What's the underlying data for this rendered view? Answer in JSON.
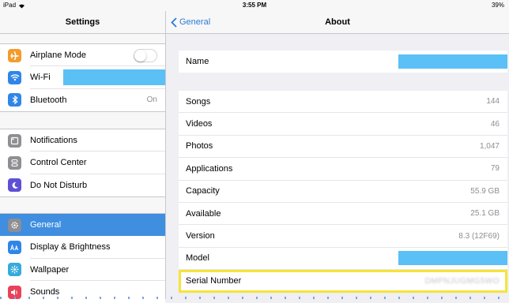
{
  "status": {
    "device": "iPad",
    "time": "3:55 PM",
    "battery": "39%"
  },
  "sidebar": {
    "title": "Settings",
    "groups": [
      {
        "items": [
          {
            "label": "Airplane Mode",
            "icon": "airplane-icon",
            "color": "#f39c2c",
            "toggle": false
          },
          {
            "label": "Wi-Fi",
            "icon": "wifi-icon",
            "color": "#2f86e8"
          },
          {
            "label": "Bluetooth",
            "icon": "bluetooth-icon",
            "color": "#2f86e8",
            "value": "On"
          }
        ]
      },
      {
        "items": [
          {
            "label": "Notifications",
            "icon": "notifications-icon",
            "color": "#8e8e93"
          },
          {
            "label": "Control Center",
            "icon": "control-center-icon",
            "color": "#8e8e93"
          },
          {
            "label": "Do Not Disturb",
            "icon": "moon-icon",
            "color": "#5e4fd6"
          }
        ]
      },
      {
        "items": [
          {
            "label": "General",
            "icon": "gear-icon",
            "color": "#8e8e93",
            "selected": true
          },
          {
            "label": "Display & Brightness",
            "icon": "display-icon",
            "color": "#2f86e8"
          },
          {
            "label": "Wallpaper",
            "icon": "wallpaper-icon",
            "color": "#36aadc"
          },
          {
            "label": "Sounds",
            "icon": "sounds-icon",
            "color": "#e8435a"
          }
        ]
      }
    ]
  },
  "detail": {
    "back_label": "General",
    "title": "About",
    "name_label": "Name",
    "rows": [
      {
        "label": "Songs",
        "value": "144"
      },
      {
        "label": "Videos",
        "value": "46"
      },
      {
        "label": "Photos",
        "value": "1,047"
      },
      {
        "label": "Applications",
        "value": "79"
      },
      {
        "label": "Capacity",
        "value": "55.9 GB"
      },
      {
        "label": "Available",
        "value": "25.1 GB"
      },
      {
        "label": "Version",
        "value": "8.3 (12F69)"
      },
      {
        "label": "Model",
        "value": ""
      },
      {
        "label": "Serial Number",
        "value": "DMPNJUGMG5WO"
      }
    ]
  },
  "colors": {
    "accent": "#2c7bd6",
    "selected": "#3f8ee0",
    "redaction": "#5bc0f5",
    "highlight": "#f5e43a"
  }
}
